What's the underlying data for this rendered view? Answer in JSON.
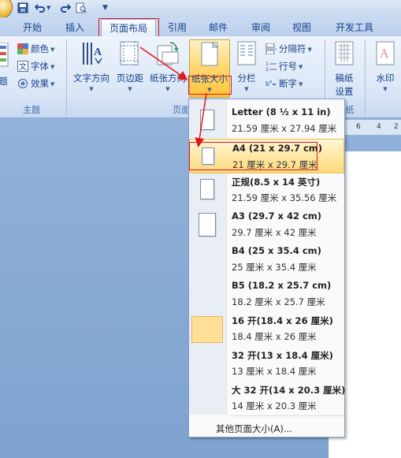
{
  "tabs": [
    {
      "label": "开始"
    },
    {
      "label": "插入"
    },
    {
      "label": "页面布局"
    },
    {
      "label": "引用"
    },
    {
      "label": "邮件"
    },
    {
      "label": "审阅"
    },
    {
      "label": "视图"
    },
    {
      "label": "开发工具"
    }
  ],
  "quick_access": {
    "save": "save-icon",
    "undo": "undo-icon",
    "redo": "redo-icon",
    "preview": "print-preview-icon",
    "customize": "▼"
  },
  "ribbon": {
    "theme": {
      "themes_label": "题",
      "colors_label": "颜色",
      "fonts_label": "字体",
      "effects_label": "效果",
      "group_label": "主题"
    },
    "page_setup": {
      "text_direction": "文字方向",
      "margins": "页边距",
      "orientation": "纸张方向",
      "paper_size": "纸张大小",
      "columns": "分栏",
      "breaks": "分隔符",
      "line_numbers": "行号",
      "hyphenation": "断字",
      "group_label": "页面"
    },
    "page_background": {
      "draft_line1": "稿纸",
      "draft_line2": "设置",
      "draft_group": "纸",
      "watermark": "水印"
    }
  },
  "ruler": {
    "num1": "6",
    "num2": "4",
    "num3": "2"
  },
  "paper_sizes": [
    {
      "name": "Letter (8 ½ x 11 in)",
      "dims": "21.59 厘米 x 27.94 厘米"
    },
    {
      "name": "A4 (21 x 29.7 cm)",
      "dims": "21 厘米 x 29.7 厘米"
    },
    {
      "name": "正规(8.5 x 14 英寸)",
      "dims": "21.59 厘米 x 35.56 厘米"
    },
    {
      "name": "A3 (29.7 x 42 cm)",
      "dims": "29.7 厘米 x 42 厘米"
    },
    {
      "name": "B4 (25 x 35.4 cm)",
      "dims": "25 厘米 x 35.4 厘米"
    },
    {
      "name": "B5 (18.2 x 25.7 cm)",
      "dims": "18.2 厘米 x 25.7 厘米"
    },
    {
      "name": "16 开(18.4 x 26 厘米)",
      "dims": "18.4 厘米 x 26 厘米"
    },
    {
      "name": "32 开(13 x 18.4 厘米)",
      "dims": "13 厘米 x 18.4 厘米"
    },
    {
      "name": "大 32 开(14 x 20.3 厘米)",
      "dims": "14 厘米 x 20.3 厘米"
    }
  ],
  "more_sizes": "其他页面大小(A)...",
  "colors": {
    "accent_red": "#e3151a",
    "hover_gold": "#ffd97a"
  }
}
